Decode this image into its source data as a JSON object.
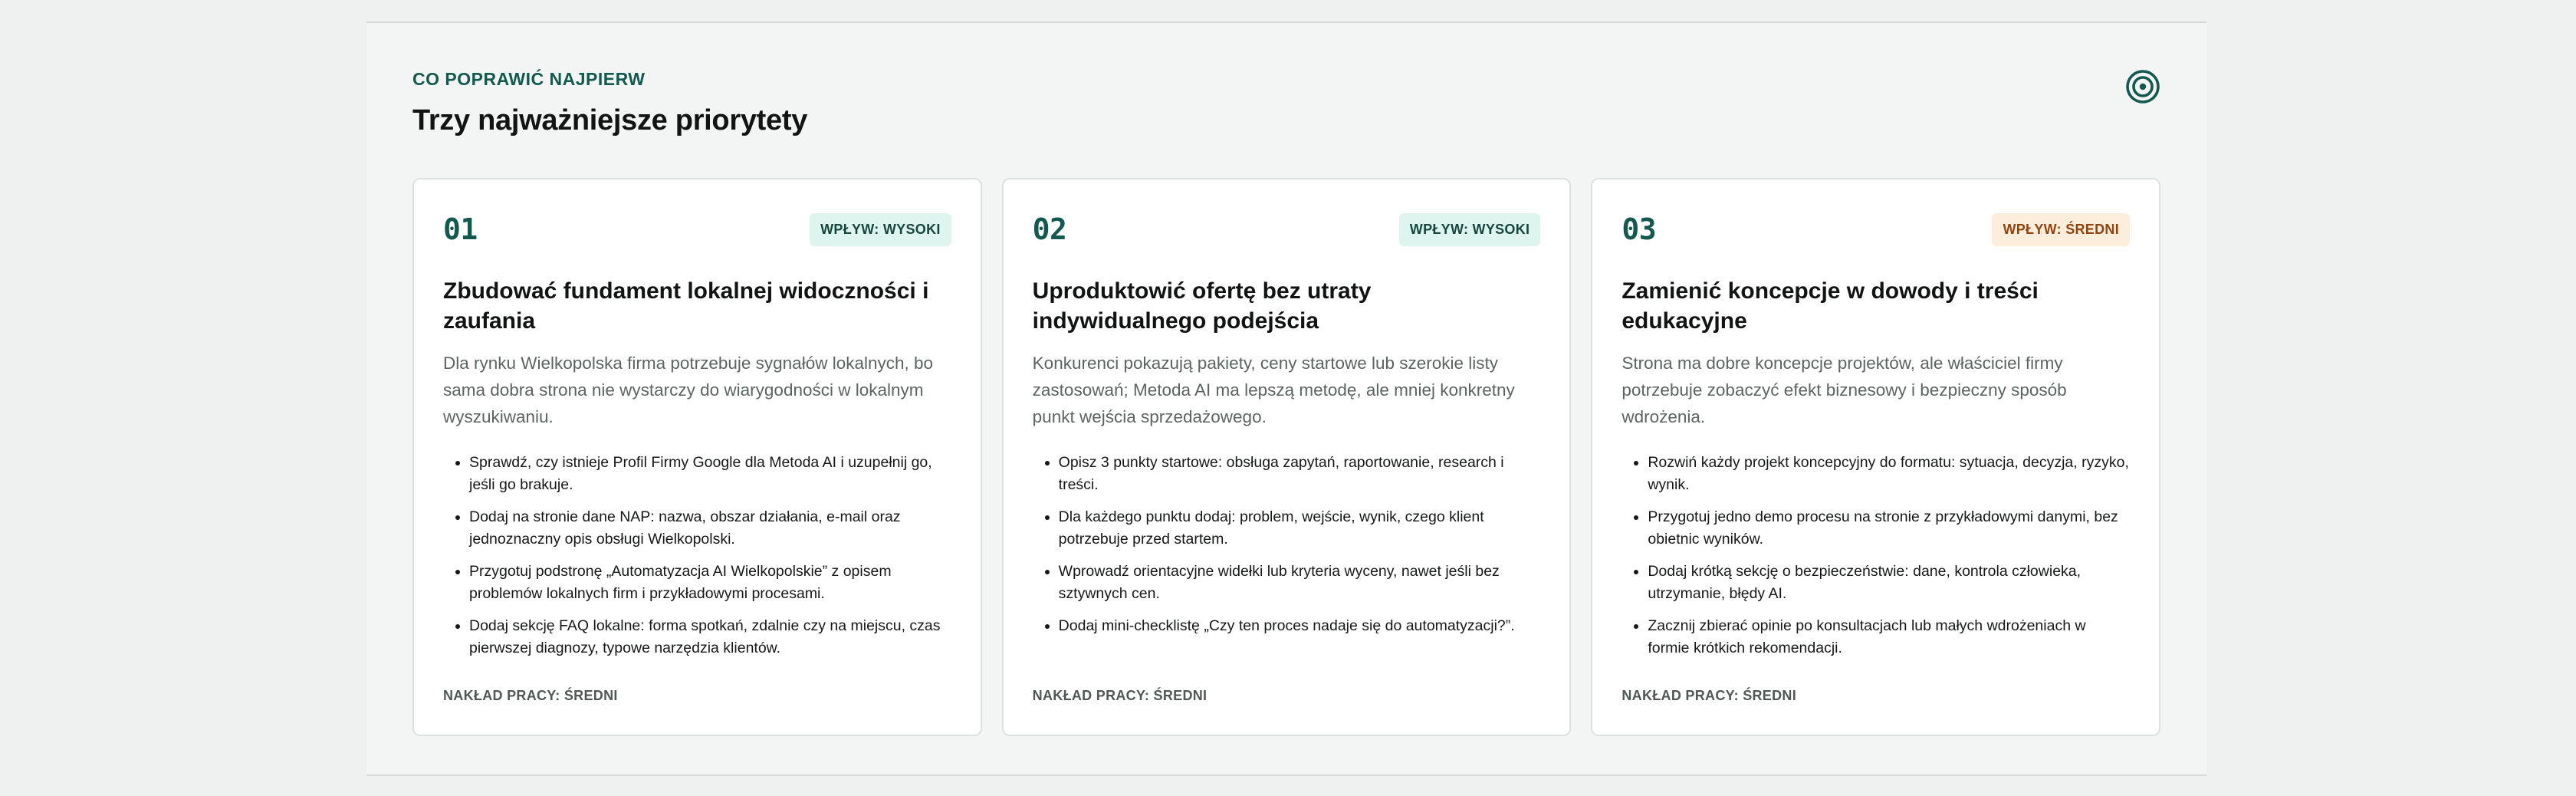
{
  "section": {
    "eyebrow": "CO POPRAWIĆ NAJPIERW",
    "title": "Trzy najważniejsze priorytety",
    "icon": "target-icon"
  },
  "colors": {
    "accent": "#13594f",
    "badge_high_bg": "#def5ef",
    "badge_medium_bg": "#fdeedb",
    "badge_medium_text": "#914410"
  },
  "cards": [
    {
      "number": "01",
      "impact": "WPŁYW: WYSOKI",
      "title": "Zbudować fundament lokalnej widoczności i zaufania",
      "description": "Dla rynku Wielkopolska firma potrzebuje sygnałów lokalnych, bo sama dobra strona nie wystarczy do wiarygodności w lokalnym wyszukiwaniu.",
      "items": [
        "Sprawdź, czy istnieje Profil Firmy Google dla Metoda AI i uzupełnij go, jeśli go brakuje.",
        "Dodaj na stronie dane NAP: nazwa, obszar działania, e-mail oraz jednoznaczny opis obsługi Wielkopolski.",
        "Przygotuj podstronę „Automatyzacja AI Wielkopolskie” z opisem problemów lokalnych firm i przykładowymi procesami.",
        "Dodaj sekcję FAQ lokalne: forma spotkań, zdalnie czy na miejscu, czas pierwszej diagnozy, typowe narzędzia klientów."
      ],
      "effort": "NAKŁAD PRACY: ŚREDNI"
    },
    {
      "number": "02",
      "impact": "WPŁYW: WYSOKI",
      "title": "Uproduktowić ofertę bez utraty indywidualnego podejścia",
      "description": "Konkurenci pokazują pakiety, ceny startowe lub szerokie listy zastosowań; Metoda AI ma lepszą metodę, ale mniej konkretny punkt wejścia sprzedażowego.",
      "items": [
        "Opisz 3 punkty startowe: obsługa zapytań, raportowanie, research i treści.",
        "Dla każdego punktu dodaj: problem, wejście, wynik, czego klient potrzebuje przed startem.",
        "Wprowadź orientacyjne widełki lub kryteria wyceny, nawet jeśli bez sztywnych cen.",
        "Dodaj mini-checklistę „Czy ten proces nadaje się do automatyzacji?”."
      ],
      "effort": "NAKŁAD PRACY: ŚREDNI"
    },
    {
      "number": "03",
      "impact": "WPŁYW: ŚREDNI",
      "title": "Zamienić koncepcje w dowody i treści edukacyjne",
      "description": "Strona ma dobre koncepcje projektów, ale właściciel firmy potrzebuje zobaczyć efekt biznesowy i bezpieczny sposób wdrożenia.",
      "items": [
        "Rozwiń każdy projekt koncepcyjny do formatu: sytuacja, decyzja, ryzyko, wynik.",
        "Przygotuj jedno demo procesu na stronie z przykładowymi danymi, bez obietnic wyników.",
        "Dodaj krótką sekcję o bezpieczeństwie: dane, kontrola człowieka, utrzymanie, błędy AI.",
        "Zacznij zbierać opinie po konsultacjach lub małych wdrożeniach w formie krótkich rekomendacji."
      ],
      "effort": "NAKŁAD PRACY: ŚREDNI"
    }
  ]
}
